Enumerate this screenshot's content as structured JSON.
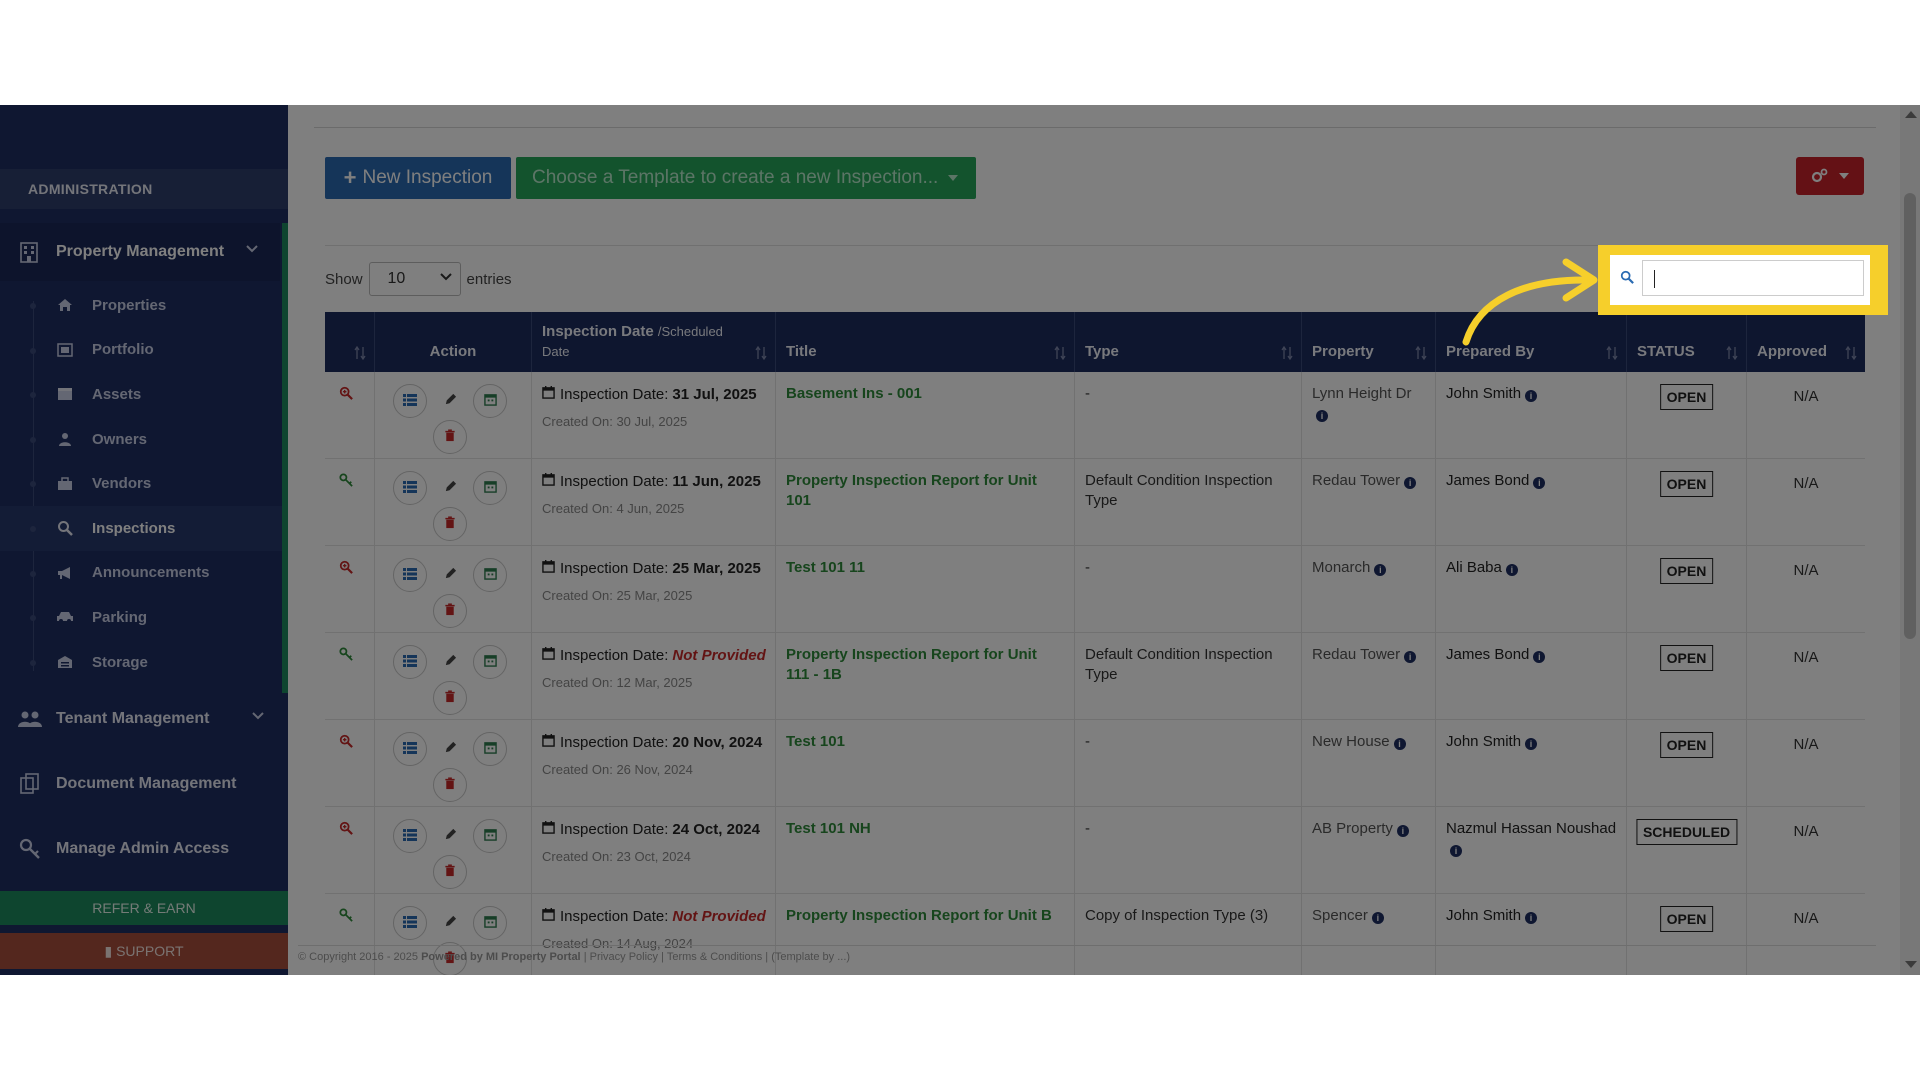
{
  "sidebar": {
    "section_title": "ADMINISTRATION",
    "property_management": "Property Management",
    "items": [
      {
        "label": "Properties",
        "icon": "home-icon"
      },
      {
        "label": "Portfolio",
        "icon": "portfolio-icon"
      },
      {
        "label": "Assets",
        "icon": "assets-icon"
      },
      {
        "label": "Owners",
        "icon": "user-icon"
      },
      {
        "label": "Vendors",
        "icon": "briefcase-icon"
      },
      {
        "label": "Inspections",
        "icon": "search-icon",
        "active": true
      },
      {
        "label": "Announcements",
        "icon": "megaphone-icon"
      },
      {
        "label": "Parking",
        "icon": "car-icon"
      },
      {
        "label": "Storage",
        "icon": "storage-icon"
      }
    ],
    "tenant_management": "Tenant Management",
    "document_management": "Document Management",
    "manage_admin_access": "Manage Admin Access",
    "refer_earn": "REFER & EARN",
    "support": "SUPPORT"
  },
  "toolbar": {
    "new_inspection": "New Inspection",
    "template_placeholder": "Choose a Template to create a new Inspection..."
  },
  "table_controls": {
    "show_label": "Show",
    "entries_value": "10",
    "entries_label": "entries",
    "search_value": ""
  },
  "table": {
    "headers": {
      "action": "Action",
      "inspection_date": "Inspection Date",
      "inspection_date_sub": "/Scheduled",
      "inspection_date_sub2": "Date",
      "title": "Title",
      "type": "Type",
      "property": "Property",
      "prepared_by": "Prepared By",
      "status": "STATUS",
      "approved": "Approved"
    },
    "date_prefix": "Inspection Date:",
    "created_prefix": "Created On:",
    "rows": [
      {
        "date": "31 Jul, 2025",
        "date_missing": false,
        "created": "30 Jul, 2025",
        "title": "Basement Ins - 001",
        "type": "-",
        "property": "Lynn Height Dr",
        "prepared_by": "John Smith",
        "status": "OPEN",
        "approved": "N/A",
        "icon": "zoom-in-icon"
      },
      {
        "date": "11 Jun, 2025",
        "date_missing": false,
        "created": "4 Jun, 2025",
        "title": "Property Inspection Report for Unit 101",
        "type": "Default Condition Inspection Type",
        "property": "Redau Tower",
        "prepared_by": "James Bond",
        "status": "OPEN",
        "approved": "N/A",
        "icon": "key-icon"
      },
      {
        "date": "25 Mar, 2025",
        "date_missing": false,
        "created": "25 Mar, 2025",
        "title": "Test 101 11",
        "type": "-",
        "property": "Monarch",
        "prepared_by": "Ali Baba",
        "status": "OPEN",
        "approved": "N/A",
        "icon": "zoom-in-icon"
      },
      {
        "date": "Not Provided",
        "date_missing": true,
        "created": "12 Mar, 2025",
        "title": "Property Inspection Report for Unit 111 - 1B",
        "type": "Default Condition Inspection Type",
        "property": "Redau Tower",
        "prepared_by": "James Bond",
        "status": "OPEN",
        "approved": "N/A",
        "icon": "key-icon"
      },
      {
        "date": "20 Nov, 2024",
        "date_missing": false,
        "created": "26 Nov, 2024",
        "title": "Test 101",
        "type": "-",
        "property": "New House",
        "prepared_by": "John Smith",
        "status": "OPEN",
        "approved": "N/A",
        "icon": "zoom-in-icon"
      },
      {
        "date": "24 Oct, 2024",
        "date_missing": false,
        "created": "23 Oct, 2024",
        "title": "Test 101 NH",
        "type": "-",
        "property": "AB Property",
        "prepared_by": "Nazmul Hassan Noushad",
        "status": "SCHEDULED",
        "approved": "N/A",
        "icon": "zoom-in-icon"
      },
      {
        "date": "Not Provided",
        "date_missing": true,
        "created": "14 Aug, 2024",
        "title": "Property Inspection Report for Unit B",
        "type": "Copy of Inspection Type (3)",
        "property": "Spencer",
        "prepared_by": "John Smith",
        "status": "OPEN",
        "approved": "N/A",
        "icon": "key-icon"
      }
    ]
  },
  "footer": {
    "copyright": "© Copyright 2016 - 2025",
    "powered": "Powered by MI Property Portal",
    "links": "| Privacy Policy | Terms & Conditions |",
    "template": "(Template by ...)"
  },
  "colors": {
    "sidebar_bg": "#1f2f63",
    "accent_green": "#27a65b",
    "primary_blue": "#2a6bb2",
    "danger_red": "#c8232b",
    "highlight_yellow": "#f6cf2b"
  }
}
